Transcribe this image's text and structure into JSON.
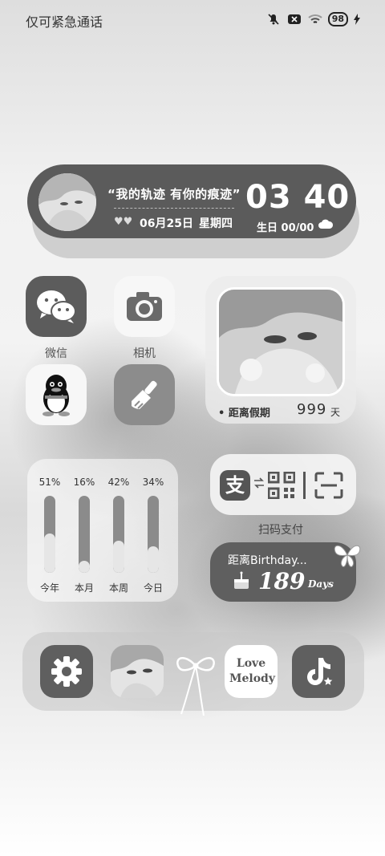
{
  "status_bar": {
    "left_text": "仅可紧急通话",
    "battery": "98",
    "icons": [
      "mute-icon",
      "no-sim-icon",
      "wifi-icon",
      "battery-icon",
      "charging-icon"
    ]
  },
  "top_widget": {
    "quote": "“我的轨迹 有你的痕迹”",
    "hearts": "♥♥",
    "date": "06月25日",
    "weekday": "星期四",
    "time": "03 40",
    "birthday": "生日 00/00"
  },
  "apps": {
    "wechat": {
      "label": "微信"
    },
    "camera": {
      "label": "相机"
    },
    "qq": {
      "label": ""
    },
    "cleaner": {
      "label": ""
    }
  },
  "photo_widget": {
    "label": "• 距离假期",
    "number": "999",
    "unit": "天"
  },
  "progress_widget": {
    "items": [
      {
        "label": "今年",
        "percent": "51%",
        "value": 0.51
      },
      {
        "label": "本月",
        "percent": "16%",
        "value": 0.16
      },
      {
        "label": "本周",
        "percent": "42%",
        "value": 0.42
      },
      {
        "label": "今日",
        "percent": "34%",
        "value": 0.34
      }
    ]
  },
  "pay_widget": {
    "alipay_char": "支",
    "label": "扫码支付"
  },
  "birthday_widget": {
    "text": "距离Birthday...",
    "number": "189",
    "unit": "Days"
  },
  "dock": {
    "love_melody": "Love Melody"
  }
}
